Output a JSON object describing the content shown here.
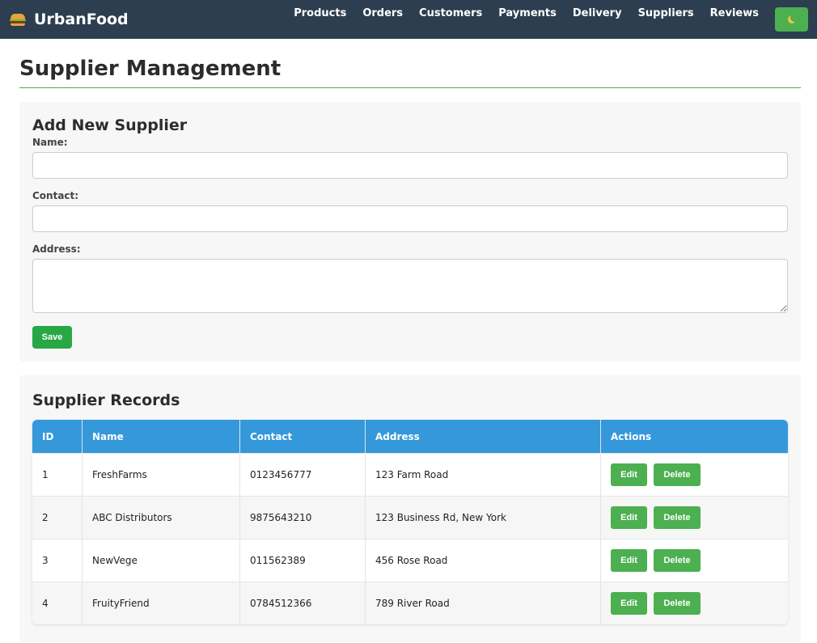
{
  "navbar": {
    "brand": "UrbanFood",
    "brand_icon": "burger-icon",
    "links": [
      "Products",
      "Orders",
      "Customers",
      "Payments",
      "Delivery",
      "Suppliers",
      "Reviews"
    ],
    "theme_toggle_icon": "moon-icon"
  },
  "page": {
    "title": "Supplier Management"
  },
  "form": {
    "title": "Add New Supplier",
    "name_label": "Name:",
    "name_value": "",
    "contact_label": "Contact:",
    "contact_value": "",
    "address_label": "Address:",
    "address_value": "",
    "save_label": "Save"
  },
  "records": {
    "title": "Supplier Records",
    "columns": [
      "ID",
      "Name",
      "Contact",
      "Address",
      "Actions"
    ],
    "rows": [
      {
        "id": "1",
        "name": "FreshFarms",
        "contact": "0123456777",
        "address": "123 Farm Road"
      },
      {
        "id": "2",
        "name": "ABC Distributors",
        "contact": "9875643210",
        "address": "123 Business Rd, New York"
      },
      {
        "id": "3",
        "name": "NewVege",
        "contact": "011562389",
        "address": "456 Rose Road"
      },
      {
        "id": "4",
        "name": "FruityFriend",
        "contact": "0784512366",
        "address": "789 River Road"
      }
    ],
    "edit_label": "Edit",
    "delete_label": "Delete"
  },
  "colors": {
    "navbar_bg": "#2c3e50",
    "accent_green": "#4caf50",
    "save_green": "#28a745",
    "table_header_blue": "#3498db",
    "card_bg": "#f7f7f7"
  }
}
